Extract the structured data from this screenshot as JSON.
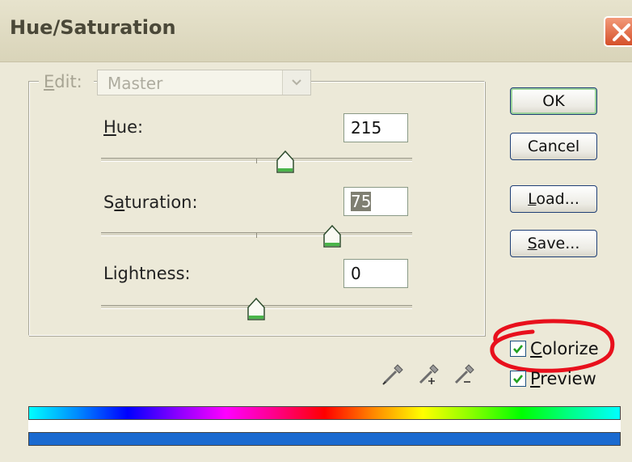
{
  "window": {
    "title": "Hue/Saturation"
  },
  "edit": {
    "label_prefix": "",
    "label_underlined": "E",
    "label_rest": "dit:",
    "value": "Master"
  },
  "hue": {
    "label_u": "H",
    "label_rest": "ue:",
    "value": "215"
  },
  "saturation": {
    "label_pre": "S",
    "label_u": "a",
    "label_rest": "turation:",
    "value": "75"
  },
  "lightness": {
    "label": "Lightness:",
    "value": "0"
  },
  "buttons": {
    "ok": "OK",
    "cancel": "Cancel",
    "load_u": "L",
    "load_rest": "oad...",
    "save_u": "S",
    "save_rest": "ave..."
  },
  "checkboxes": {
    "colorize_u": "C",
    "colorize_rest": "olorize",
    "colorize_checked": true,
    "preview_u": "P",
    "preview_rest": "review",
    "preview_checked": true
  },
  "colors": {
    "highlight_oval": "#e8101c",
    "result_bar": "#1a6ad0"
  },
  "icons": [
    "close-icon",
    "eyedropper-icon",
    "eyedropper-add-icon",
    "eyedropper-subtract-icon",
    "checkmark-icon",
    "chevron-down-icon"
  ]
}
